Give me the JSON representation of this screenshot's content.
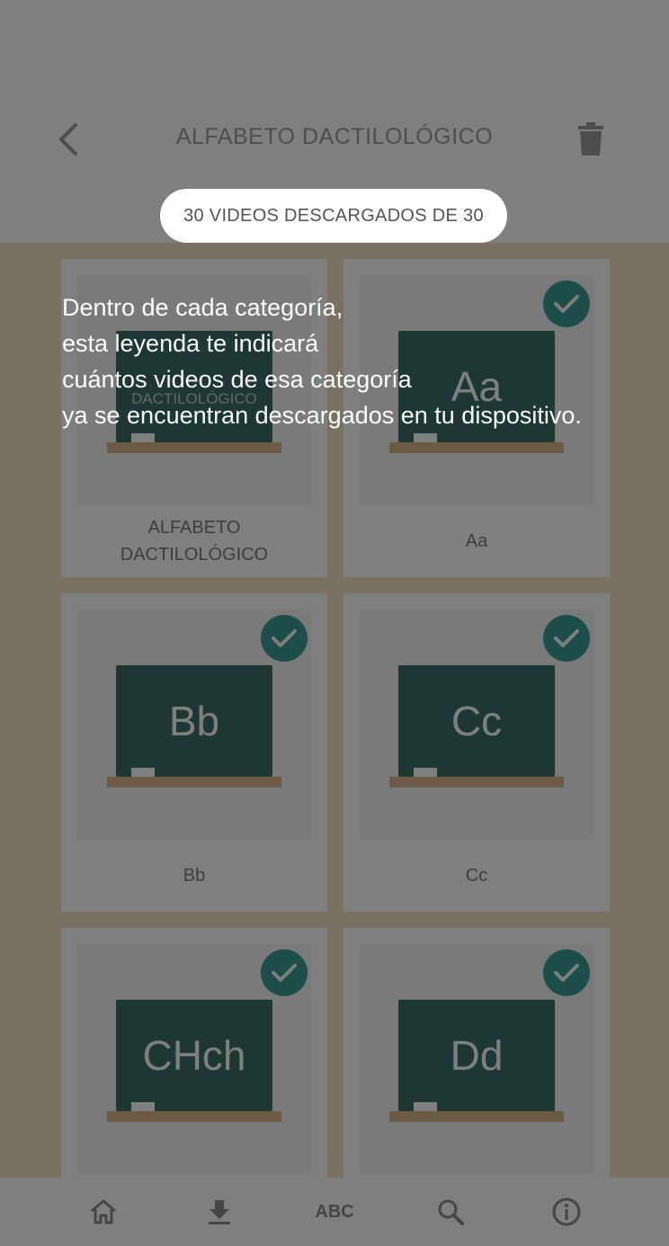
{
  "header": {
    "title": "ALFABETO DACTILOLÓGICO",
    "back_icon": "chevron-left-icon",
    "trash_icon": "trash-icon"
  },
  "cards": [
    {
      "board_text": "DACTILOLÓGICO",
      "label": "ALFABETO\nDACTILOLÓGICO",
      "checked": true
    },
    {
      "board_text": "Aa",
      "label": "Aa",
      "checked": true
    },
    {
      "board_text": "Bb",
      "label": "Bb",
      "checked": true
    },
    {
      "board_text": "Cc",
      "label": "Cc",
      "checked": true
    },
    {
      "board_text": "CHch",
      "label": "",
      "checked": true
    },
    {
      "board_text": "Dd",
      "label": "",
      "checked": true
    }
  ],
  "bottom_nav": {
    "items": [
      {
        "icon": "home-icon",
        "label": ""
      },
      {
        "icon": "download-icon",
        "label": ""
      },
      {
        "icon": "abc-icon",
        "label": "ABC"
      },
      {
        "icon": "search-icon",
        "label": ""
      },
      {
        "icon": "info-icon",
        "label": ""
      }
    ]
  },
  "tutorial": {
    "badge": "30 VIDEOS DESCARGADOS DE 30",
    "lines": [
      "Dentro de cada categoría,",
      "esta leyenda te indicará",
      "cuántos videos de esa categoría",
      "ya se encuentran descargados en tu dispositivo."
    ]
  },
  "colors": {
    "background": "#f3e3c8",
    "board": "#3b6f6b",
    "check": "#3a9c95",
    "ledge": "#d8b48a",
    "overlay": "rgba(0,0,0,0.5)"
  }
}
